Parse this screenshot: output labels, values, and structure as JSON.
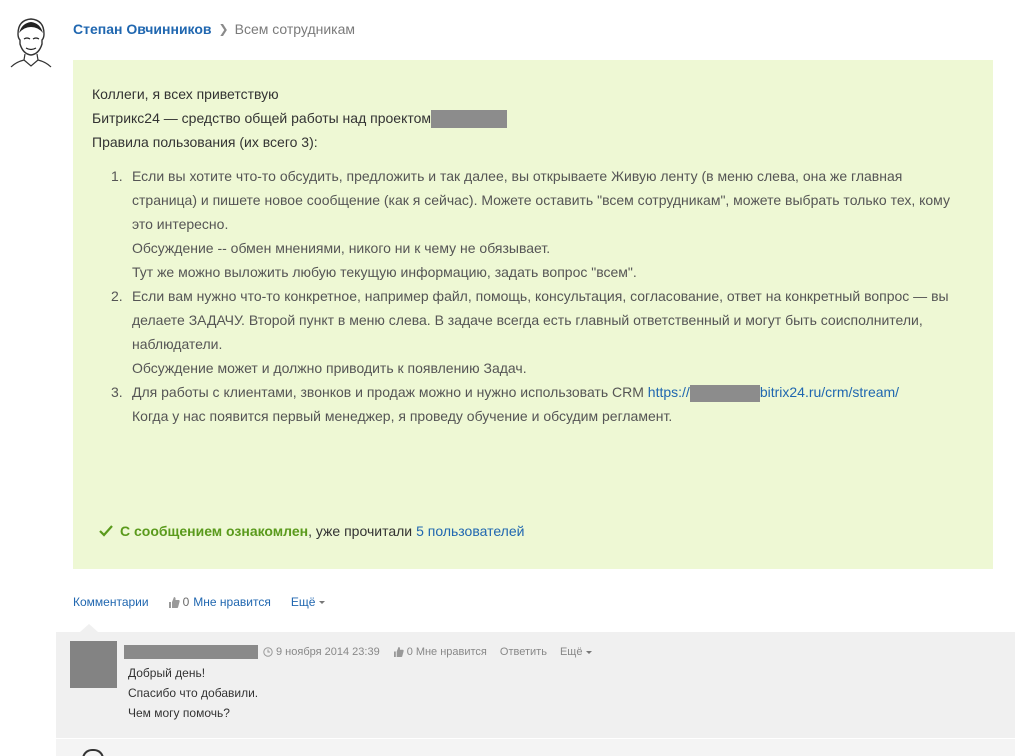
{
  "post": {
    "author": "Степан Овчинников",
    "audience": "Всем сотрудникам",
    "lines": [
      "Коллеги, я всех приветствую",
      "Битрикс24 — средство общей работы над проектом",
      "Правила пользования (их всего 3):"
    ],
    "rules": [
      {
        "num": "1.",
        "lines": [
          "Если вы хотите что-то обсудить, предложить и так далее, вы открываете Живую ленту (в меню слева, она же главная",
          "страница) и пишете новое сообщение (как я сейчас). Можете оставить \"всем сотрудникам\", можете выбрать только тех, кому",
          "это интересно.",
          "Обсуждение -- обмен мнениями, никого ни к чему не обязывает.",
          "Тут же можно выложить любую текущую информацию, задать вопрос \"всем\"."
        ]
      },
      {
        "num": "2.",
        "lines": [
          "Если вам нужно что-то конкретное, например файл, помощь, консультация, согласование, ответ на конкретный вопрос — вы",
          "делаете ЗАДАЧУ. Второй пункт в меню слева. В задаче всегда есть главный ответственный и могут быть соисполнители,",
          "наблюдатели.",
          "Обсуждение может и должно приводить к появлению Задач."
        ]
      },
      {
        "num": "3.",
        "line1_text": "Для работы с клиентами, звонков и продаж можно и нужно использовать CRM",
        "link_prefix": "https://",
        "link_suffix": "bitrix24.ru/crm/stream/",
        "line2": "Когда у нас появится первый менеджер, я проведу обучение и обсудим регламент."
      }
    ],
    "read_status": {
      "strong": "С сообщением ознакомлен",
      "mid": ", уже прочитали",
      "link": "5 пользователей"
    }
  },
  "actions": {
    "comments": "Комментарии",
    "like_count": "0",
    "like_label": "Мне нравится",
    "more": "Ещё"
  },
  "comment": {
    "date": "9 ноября 2014 23:39",
    "like_count": "0",
    "like_label": "Мне нравится",
    "reply": "Ответить",
    "more": "Ещё",
    "lines": [
      "Добрый день!",
      "Спасибо что добавили.",
      "Чем могу помочь?"
    ]
  },
  "colors": {
    "post_bg": "#eef8d4",
    "link": "#2067b0",
    "read_green": "#5a9a1c",
    "comment_bg": "#f0f0f0"
  }
}
